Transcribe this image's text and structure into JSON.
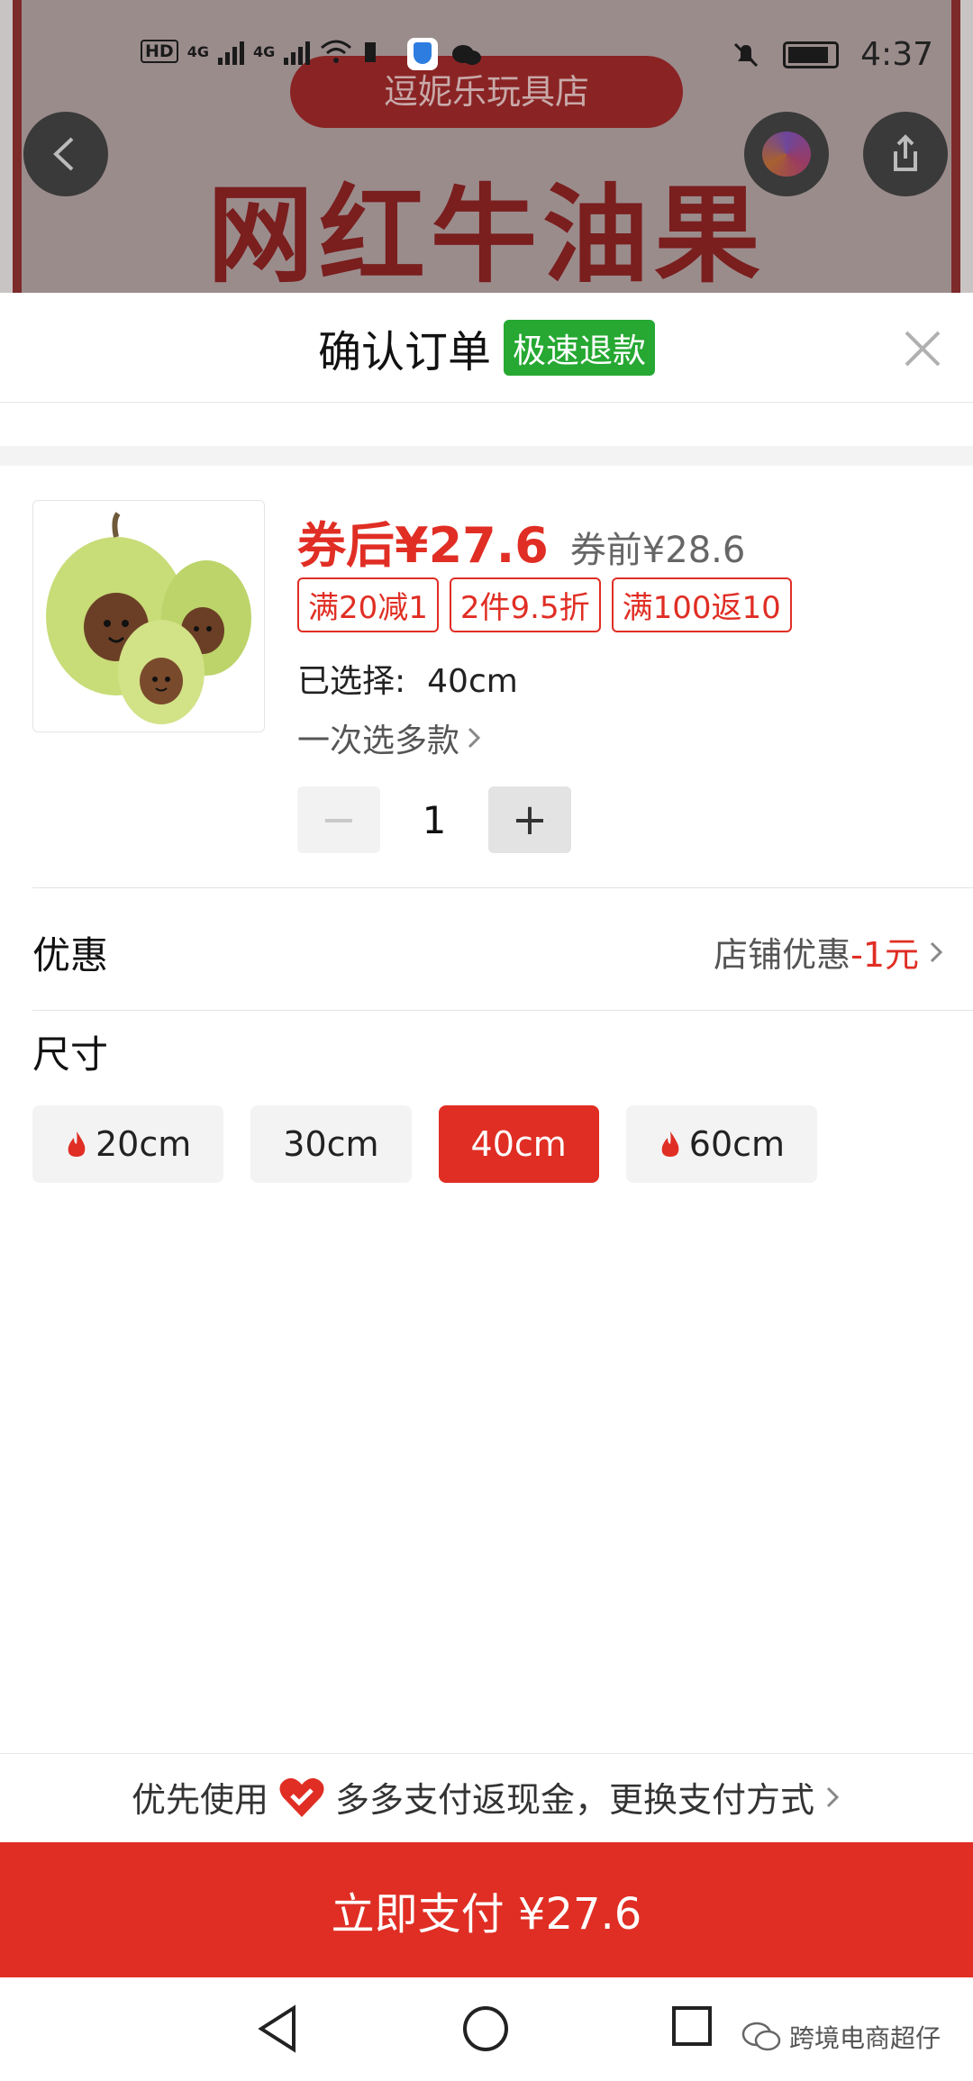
{
  "background": {
    "store_name": "逗妮乐玩具店",
    "headline": "网红牛油果"
  },
  "status_bar": {
    "hd": "HD",
    "network_1": "4G",
    "network_2": "4G",
    "time": "4:37"
  },
  "sheet": {
    "title": "确认订单",
    "refund_badge": "极速退款",
    "close_icon": "close-icon"
  },
  "product": {
    "price_after_coupon": "券后¥27.6",
    "price_before_coupon": "券前¥28.6",
    "promotions": [
      "满20减1",
      "2件9.5折",
      "满100返10"
    ],
    "selected_label": "已选择:",
    "selected_value": "40cm",
    "multi_select": "一次选多款",
    "quantity": "1",
    "minus_symbol": "−",
    "plus_symbol": "+"
  },
  "discount": {
    "label": "优惠",
    "shop_discount_label": "店铺优惠",
    "shop_discount_amount": "-1元"
  },
  "size": {
    "label": "尺寸",
    "options": [
      {
        "label": "20cm",
        "hot": true
      },
      {
        "label": "30cm",
        "hot": false
      },
      {
        "label": "40cm",
        "hot": false,
        "selected": true
      },
      {
        "label": "60cm",
        "hot": true
      }
    ]
  },
  "payment": {
    "prefer_prefix": "优先使用",
    "prefer_text": "多多支付返现金，更换支付方式",
    "pay_button": "立即支付 ¥27.6"
  },
  "watermark": "跨境电商超仔",
  "colors": {
    "brand_red": "#e02e24",
    "refund_green": "#26a832"
  }
}
